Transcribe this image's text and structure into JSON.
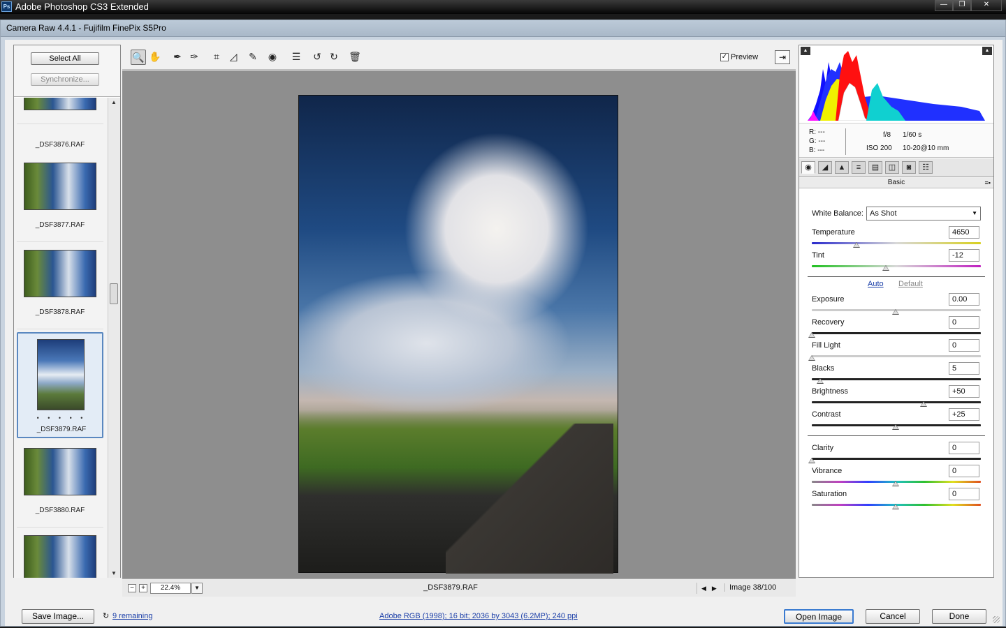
{
  "os": {
    "title": "Adobe Photoshop CS3 Extended",
    "app_icon": "Ps",
    "buttons": {
      "minimize": "—",
      "maximize": "❐",
      "close": "✕"
    }
  },
  "dialog": {
    "title": "Camera Raw 4.4.1  -  Fujifilm FinePix S5Pro"
  },
  "filmstrip": {
    "select_all": "Select All",
    "synchronize": "Synchronize...",
    "items": [
      {
        "name": "_DSF3876.RAF"
      },
      {
        "name": "_DSF3877.RAF"
      },
      {
        "name": "_DSF3878.RAF"
      },
      {
        "name": "_DSF3879.RAF",
        "selected": true,
        "rating": "• • • • •"
      },
      {
        "name": "_DSF3880.RAF"
      },
      {
        "name": ""
      }
    ],
    "scroll_up": "▲",
    "scroll_down": "▼"
  },
  "toolbar": {
    "tools": [
      {
        "name": "zoom-tool",
        "glyph": "🔍"
      },
      {
        "name": "hand-tool",
        "glyph": "✋"
      },
      {
        "name": "white-balance-tool",
        "glyph": "✒"
      },
      {
        "name": "color-sampler-tool",
        "glyph": "✑"
      },
      {
        "name": "crop-tool",
        "glyph": "⌗"
      },
      {
        "name": "straighten-tool",
        "glyph": "◿"
      },
      {
        "name": "retouch-tool",
        "glyph": "✎"
      },
      {
        "name": "red-eye-tool",
        "glyph": "◉"
      },
      {
        "name": "preferences-tool",
        "glyph": "☰"
      },
      {
        "name": "rotate-left-tool",
        "glyph": "↺"
      },
      {
        "name": "rotate-right-tool",
        "glyph": "↻"
      },
      {
        "name": "trash-tool",
        "glyph": "🗑"
      }
    ],
    "preview_label": "Preview",
    "preview_checked": "✓",
    "fullscreen_glyph": "⇥"
  },
  "status": {
    "zoom_out": "−",
    "zoom_in": "+",
    "zoom": "22.4%",
    "zoom_dropdown": "▼",
    "filename": "_DSF3879.RAF",
    "prev": "◀",
    "next": "▶",
    "image_count": "Image 38/100"
  },
  "readout": {
    "r": "R:  ---",
    "g": "G:  ---",
    "b": "B:  ---",
    "aperture": "f/8",
    "shutter": "1/60 s",
    "iso": "ISO 200",
    "lens": "10-20@10 mm"
  },
  "histogram": {
    "shadow_clip": "▲",
    "highlight_clip": "▲"
  },
  "panel": {
    "tabs": [
      "◉",
      "◢",
      "▲",
      "≡",
      "▤",
      "◫",
      "◙",
      "☷"
    ],
    "section": "Basic",
    "section_menu": "≡▪",
    "white_balance_label": "White Balance:",
    "white_balance_value": "As Shot",
    "white_balance_arrow": "▼",
    "auto": "Auto",
    "default": "Default",
    "sliders": {
      "temperature": {
        "label": "Temperature",
        "value": "4650"
      },
      "tint": {
        "label": "Tint",
        "value": "-12"
      },
      "exposure": {
        "label": "Exposure",
        "value": "0.00"
      },
      "recovery": {
        "label": "Recovery",
        "value": "0"
      },
      "fill_light": {
        "label": "Fill Light",
        "value": "0"
      },
      "blacks": {
        "label": "Blacks",
        "value": "5"
      },
      "brightness": {
        "label": "Brightness",
        "value": "+50"
      },
      "contrast": {
        "label": "Contrast",
        "value": "+25"
      },
      "clarity": {
        "label": "Clarity",
        "value": "0"
      },
      "vibrance": {
        "label": "Vibrance",
        "value": "0"
      },
      "saturation": {
        "label": "Saturation",
        "value": "0"
      }
    }
  },
  "bottom": {
    "save": "Save Image...",
    "remaining_icon": "↻",
    "remaining": "9 remaining",
    "workflow": "Adobe RGB (1998); 16 bit; 2036 by 3043 (6.2MP); 240 ppi",
    "open": "Open Image",
    "cancel": "Cancel",
    "done": "Done"
  }
}
